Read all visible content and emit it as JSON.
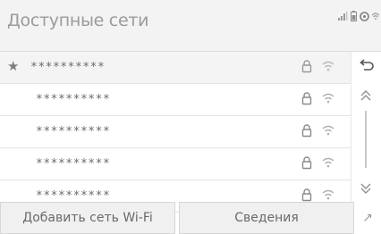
{
  "header": {
    "title": "Доступные сети"
  },
  "networks": [
    {
      "starred": "★",
      "ssid": "**********"
    },
    {
      "starred": "",
      "ssid": "**********"
    },
    {
      "starred": "",
      "ssid": "**********"
    },
    {
      "starred": "",
      "ssid": "**********"
    },
    {
      "starred": "",
      "ssid": "**********"
    }
  ],
  "buttons": {
    "add_network": "Добавить сеть Wi-Fi",
    "details": "Сведения",
    "more": "↗"
  },
  "icons": {
    "back": "back-arrow-icon",
    "scroll_up": "chevron-double-up-icon",
    "scroll_down": "chevron-double-down-icon",
    "lock": "lock-icon",
    "wifi": "wifi-icon"
  }
}
